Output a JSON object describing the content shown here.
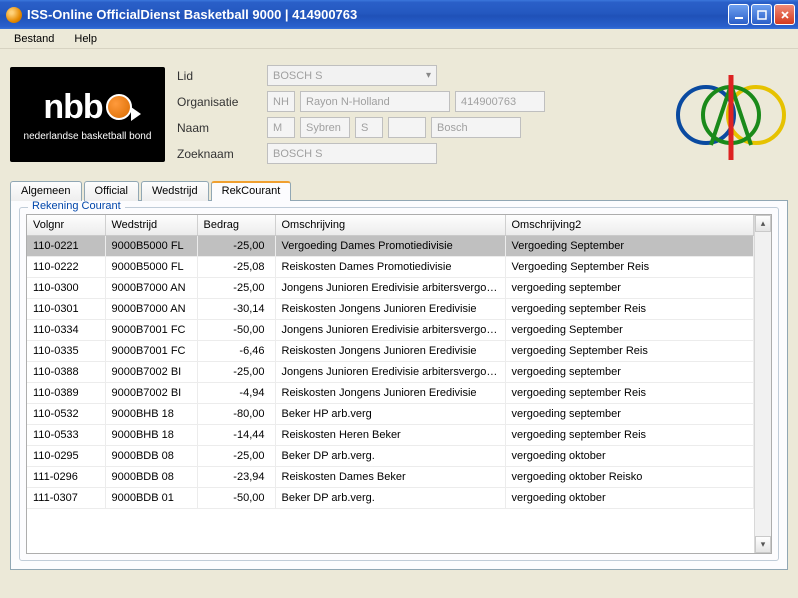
{
  "window": {
    "title": "ISS-Online OfficialDienst Basketball 9000 | 414900763"
  },
  "menu": {
    "bestand": "Bestand",
    "help": "Help"
  },
  "logo": {
    "main": "nbb",
    "sub": "nederlandse basketball bond"
  },
  "form": {
    "labels": {
      "lid": "Lid",
      "organisatie": "Organisatie",
      "naam": "Naam",
      "zoeknaam": "Zoeknaam"
    },
    "lid": "BOSCH S",
    "org_code": "NH",
    "org_name": "Rayon N-Holland",
    "org_id": "414900763",
    "naam_prefix": "M",
    "naam_first": "Sybren",
    "naam_initial": "S",
    "naam_mid": "",
    "naam_last": "Bosch",
    "zoeknaam": "BOSCH S"
  },
  "tabs": {
    "algemeen": "Algemeen",
    "official": "Official",
    "wedstrijd": "Wedstrijd",
    "rekcourant": "RekCourant"
  },
  "group": {
    "title": "Rekening Courant"
  },
  "columns": {
    "volgnr": "Volgnr",
    "wedstrijd": "Wedstrijd",
    "bedrag": "Bedrag",
    "oms": "Omschrijving",
    "oms2": "Omschrijving2"
  },
  "rows": [
    {
      "volgnr": "110-0221",
      "wed": "9000B5000 FL",
      "bedrag": "-25,00",
      "oms": "Vergoeding Dames Promotiedivisie",
      "oms2": "Vergoeding September"
    },
    {
      "volgnr": "110-0222",
      "wed": "9000B5000 FL",
      "bedrag": "-25,08",
      "oms": "Reiskosten Dames Promotiedivisie",
      "oms2": "Vergoeding September Reis"
    },
    {
      "volgnr": "110-0300",
      "wed": "9000B7000 AN",
      "bedrag": "-25,00",
      "oms": "Jongens Junioren Eredivisie arbitersvergoedi...",
      "oms2": "vergoeding september"
    },
    {
      "volgnr": "110-0301",
      "wed": "9000B7000 AN",
      "bedrag": "-30,14",
      "oms": "Reiskosten Jongens Junioren Eredivisie",
      "oms2": "vergoeding september Reis"
    },
    {
      "volgnr": "110-0334",
      "wed": "9000B7001 FC",
      "bedrag": "-50,00",
      "oms": "Jongens Junioren Eredivisie arbitersvergoedi...",
      "oms2": "vergoeding September"
    },
    {
      "volgnr": "110-0335",
      "wed": "9000B7001 FC",
      "bedrag": "-6,46",
      "oms": "Reiskosten Jongens Junioren Eredivisie",
      "oms2": "vergoeding September Reis"
    },
    {
      "volgnr": "110-0388",
      "wed": "9000B7002 BI",
      "bedrag": "-25,00",
      "oms": "Jongens Junioren Eredivisie arbitersvergoedi...",
      "oms2": "vergoeding september"
    },
    {
      "volgnr": "110-0389",
      "wed": "9000B7002 BI",
      "bedrag": "-4,94",
      "oms": "Reiskosten Jongens Junioren Eredivisie",
      "oms2": "vergoeding september Reis"
    },
    {
      "volgnr": "110-0532",
      "wed": "9000BHB   18",
      "bedrag": "-80,00",
      "oms": "Beker HP arb.verg",
      "oms2": "vergoeding september"
    },
    {
      "volgnr": "110-0533",
      "wed": "9000BHB   18",
      "bedrag": "-14,44",
      "oms": "Reiskosten Heren Beker",
      "oms2": "vergoeding september Reis"
    },
    {
      "volgnr": "110-0295",
      "wed": "9000BDB   08",
      "bedrag": "-25,00",
      "oms": "Beker DP arb.verg.",
      "oms2": "vergoeding oktober"
    },
    {
      "volgnr": "111-0296",
      "wed": "9000BDB   08",
      "bedrag": "-23,94",
      "oms": "Reiskosten Dames Beker",
      "oms2": "vergoeding oktober Reisko"
    },
    {
      "volgnr": "111-0307",
      "wed": "9000BDB   01",
      "bedrag": "-50,00",
      "oms": "Beker DP arb.verg.",
      "oms2": "vergoeding oktober"
    }
  ]
}
